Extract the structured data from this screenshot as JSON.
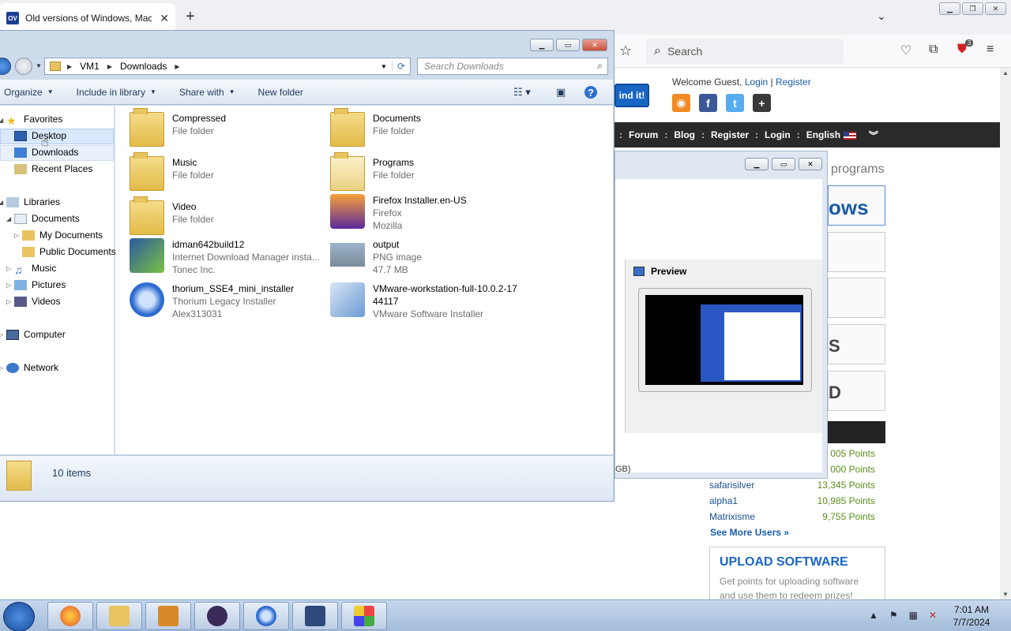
{
  "browser": {
    "tab_title": "Old versions of Windows, Mac",
    "tab_favicon_text": "OV",
    "search_placeholder": "Search",
    "badge_count": "3"
  },
  "site": {
    "find_button": "ind it!",
    "welcome": "Welcome Guest,",
    "login": "Login",
    "register": "Register",
    "nav": [
      "Forum",
      "Blog",
      "Register",
      "Login",
      "English"
    ],
    "programs_text": "programs",
    "box_words": [
      "ows",
      "",
      "",
      "S",
      "D"
    ],
    "points": [
      {
        "name": "",
        "points": "005 Points"
      },
      {
        "name": "",
        "points": "000 Points"
      },
      {
        "name": "safarisilver",
        "points": "13,345 Points"
      },
      {
        "name": "alpha1",
        "points": "10,985 Points"
      },
      {
        "name": "Matrixisme",
        "points": "9,755 Points"
      }
    ],
    "see_more": "See More Users »",
    "upload_title": "UPLOAD SOFTWARE",
    "upload_desc_1": "Get points for uploading software",
    "upload_desc_2": "and use them to redeem prizes!"
  },
  "window2": {
    "preview_label": "Preview",
    "gb_text": "GB)"
  },
  "explorer": {
    "breadcrumb": [
      "VM1",
      "Downloads"
    ],
    "search_placeholder": "Search Downloads",
    "commands": [
      "Organize",
      "Include in library",
      "Share with",
      "New folder"
    ],
    "nav": {
      "favorites": "Favorites",
      "desktop": "Desktop",
      "downloads": "Downloads",
      "recent": "Recent Places",
      "libraries": "Libraries",
      "documents": "Documents",
      "my_documents": "My Documents",
      "public_documents": "Public Documents",
      "music": "Music",
      "pictures": "Pictures",
      "videos": "Videos",
      "computer": "Computer",
      "network": "Network"
    },
    "files": [
      {
        "name": "Compressed",
        "line2": "File folder",
        "line3": ""
      },
      {
        "name": "Documents",
        "line2": "File folder",
        "line3": ""
      },
      {
        "name": "Music",
        "line2": "File folder",
        "line3": ""
      },
      {
        "name": "Programs",
        "line2": "File folder",
        "line3": ""
      },
      {
        "name": "Video",
        "line2": "File folder",
        "line3": ""
      },
      {
        "name": "Firefox Installer.en-US",
        "line2": "Firefox",
        "line3": "Mozilla"
      },
      {
        "name": "idman642build12",
        "line2": "Internet Download Manager insta...",
        "line3": "Tonec Inc."
      },
      {
        "name": "output",
        "line2": "PNG image",
        "line3": "47.7 MB"
      },
      {
        "name": "thorium_SSE4_mini_installer",
        "line2": "Thorium Legacy Installer",
        "line3": "Alex313031"
      },
      {
        "name": "VMware-workstation-full-10.0.2-17",
        "name2": "44117",
        "line2": "VMware Software Installer",
        "line3": ""
      }
    ],
    "item_count": "10 items"
  },
  "taskbar": {
    "time": "7:01 AM",
    "date": "7/7/2024"
  }
}
